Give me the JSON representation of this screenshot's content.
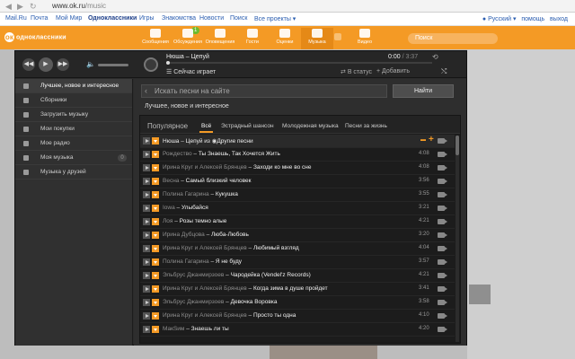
{
  "browser": {
    "url_domain": "www.ok.ru",
    "url_path": "/music"
  },
  "portal": {
    "links": [
      "Mail.Ru",
      "Почта",
      "Мой Мир",
      "Одноклассники",
      "Игры",
      "Знакомства",
      "Новости",
      "Поиск",
      "Все проекты ▾"
    ],
    "right_links": [
      "Русский ▾",
      "помощь",
      "выход"
    ]
  },
  "ok_header": {
    "logo": "одноклассники",
    "items": [
      "Сообщения",
      "Обсуждения",
      "Оповещения",
      "Гости",
      "Оценки",
      "Музыка",
      "Видео"
    ],
    "active_item": "Музыка",
    "discussions_badge": "1",
    "search_placeholder": "Поиск",
    "accent_color": "#f49a25"
  },
  "player": {
    "now_title": "Нюша – Цепуй",
    "time_current": "0:00",
    "time_total": "/ 3:37",
    "now_playing_label": "Сейчас играет",
    "to_status": "В статус",
    "add": "+ Добавить"
  },
  "sidebar": {
    "items": [
      {
        "label": "Лучшее, новое и интересное",
        "icon": "star-icon"
      },
      {
        "label": "Сборники",
        "icon": "collection-icon"
      },
      {
        "label": "Загрузить музыку",
        "icon": "upload-icon"
      },
      {
        "label": "Мои покупки",
        "icon": "cart-icon"
      },
      {
        "label": "Мое радио",
        "icon": "radio-icon"
      },
      {
        "label": "Моя музыка",
        "icon": "note-icon",
        "count": "0"
      },
      {
        "label": "Музыка у друзей",
        "icon": "friends-icon"
      }
    ]
  },
  "search": {
    "placeholder": "Искать песни на сайте",
    "button": "Найти"
  },
  "breadcrumb": "Лучшее, новое и интересное",
  "list": {
    "heading": "Популярное",
    "tabs": [
      "Всё",
      "Эстрадный шансон",
      "Молодежная музыка",
      "Песни за жизнь"
    ],
    "tracks": [
      {
        "artist": "Нюша",
        "title": "Цепуй",
        "extra": "из",
        "album": "Другие песни"
      },
      {
        "artist": "Рождество",
        "title": "Ты Знаешь, Так Хочется Жить",
        "duration": "4:08"
      },
      {
        "artist": "Ирина Круг и Алексей Брянцев",
        "title": "Заходи ко мне во сне",
        "duration": "4:08"
      },
      {
        "artist": "Весна",
        "title": "Самый близкий человек",
        "duration": "3:56"
      },
      {
        "artist": "Полина Гагарина",
        "title": "Кукушка",
        "duration": "3:55"
      },
      {
        "artist": "Iowa",
        "title": "Улыбайся",
        "duration": "3:21"
      },
      {
        "artist": "Лоя",
        "title": "Розы темно алые",
        "duration": "4:21"
      },
      {
        "artist": "Ирина Дубцова",
        "title": "Люба-Любовь",
        "duration": "3:20"
      },
      {
        "artist": "Ирина Круг и Алексей Брянцев",
        "title": "Любимый взгляд",
        "duration": "4:04"
      },
      {
        "artist": "Полина Гагарина",
        "title": "Я не буду",
        "duration": "3:57"
      },
      {
        "artist": "Эльбрус Джанмирзоев",
        "title": "Чародейка (Vendel'z Records)",
        "duration": "4:21"
      },
      {
        "artist": "Ирина Круг и Алексей Брянцев",
        "title": "Когда зима в душе пройдет",
        "duration": "3:41"
      },
      {
        "artist": "Эльбрус Джанмирзоев",
        "title": "Девочка Воровка",
        "duration": "3:58"
      },
      {
        "artist": "Ирина Круг и Алексей Брянцев",
        "title": "Просто ты одна",
        "duration": "4:10"
      },
      {
        "artist": "МакSим",
        "title": "Знаешь ли ты",
        "duration": "4:20"
      }
    ]
  }
}
